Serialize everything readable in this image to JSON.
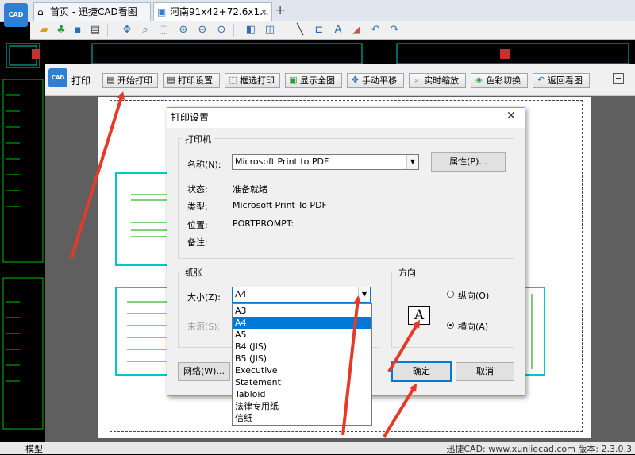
{
  "tabs": [
    {
      "label": "首页 - 迅捷CAD看图"
    },
    {
      "label": "河南91x42+72.6x1..."
    }
  ],
  "app_logo": "CAD",
  "print_window": {
    "title": "打印",
    "logo": "CAD",
    "buttons": [
      "开始打印",
      "打印设置",
      "框选打印",
      "显示全图",
      "手动平移",
      "实时缩放",
      "色彩切换",
      "返回看图"
    ]
  },
  "dialog": {
    "title": "打印设置",
    "printer_group": "打印机",
    "name_label": "名称(N):",
    "printer_name": "Microsoft Print to PDF",
    "properties_button": "属性(P)...",
    "status_label": "状态:",
    "status_value": "准备就绪",
    "type_label": "类型:",
    "type_value": "Microsoft Print To PDF",
    "location_label": "位置:",
    "location_value": "PORTPROMPT:",
    "comment_label": "备注:",
    "paper_group": "纸张",
    "size_label": "大小(Z):",
    "size_value": "A4",
    "source_label": "来源(S):",
    "size_options": [
      "A3",
      "A4",
      "A5",
      "B4 (JIS)",
      "B5 (JIS)",
      "Executive",
      "Statement",
      "Tabloid",
      "法律专用纸",
      "信纸"
    ],
    "selected_option": "A4",
    "orientation_group": "方向",
    "portrait_label": "纵向(O)",
    "landscape_label": "横向(A)",
    "orientation_glyph": "A",
    "network_button": "网络(W)...",
    "ok_button": "确定",
    "cancel_button": "取消"
  },
  "status": {
    "left": "模型",
    "right": "迅捷CAD: www.xunjiecad.com 版本: 2.3.0.3"
  },
  "colors": {
    "accent": "#0078d7",
    "arrow": "#e53a2a",
    "cad_green": "#00c000",
    "cad_cyan": "#00c8c8"
  }
}
